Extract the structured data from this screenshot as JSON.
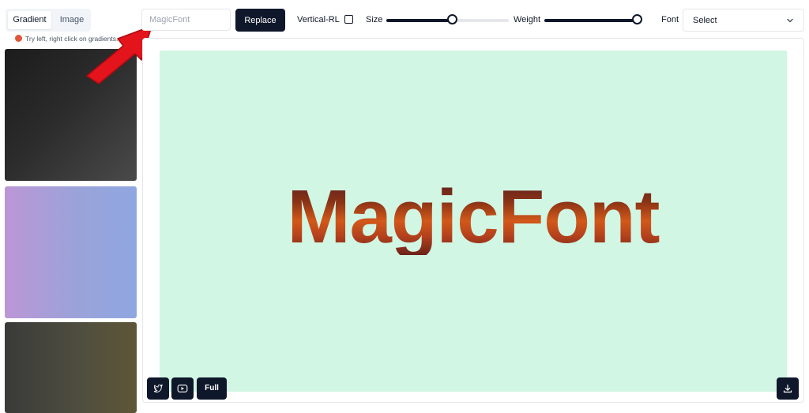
{
  "tabs": [
    {
      "label": "Gradient",
      "active": true
    },
    {
      "label": "Image",
      "active": false
    }
  ],
  "hint": "Try left, right click on gradients.",
  "toolbar": {
    "text_value": "MagicFont",
    "replace_label": "Replace",
    "vertical_label": "Vertical-RL",
    "vertical_checked": false,
    "size_label": "Size",
    "size_value": 0.54,
    "weight_label": "Weight",
    "weight_value": 0.97,
    "font_label": "Font",
    "font_select_value": "Select"
  },
  "canvas": {
    "background": "#d1f6e4",
    "text": "MagicFont"
  },
  "bottom_buttons": {
    "full_label": "Full"
  },
  "icons": [
    "twitter-icon",
    "youtube-icon",
    "download-icon",
    "chevron-down-icon",
    "red-arrow-annotation"
  ],
  "colors": {
    "accent": "#0f172a",
    "arrow": "#e3141b"
  }
}
